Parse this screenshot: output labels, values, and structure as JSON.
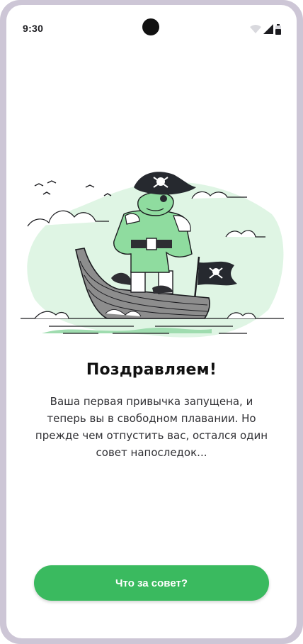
{
  "status_bar": {
    "time": "9:30",
    "icons": [
      "wifi-icon",
      "signal-icon",
      "battery-icon"
    ]
  },
  "illustration": {
    "subject": "pirate-frog-in-boat-illustration"
  },
  "content": {
    "title": "Поздравляем!",
    "body": "Ваша первая привычка запущена, и теперь вы в свободном плавании. Но прежде чем отпустить вас, остался один совет напоследок..."
  },
  "cta": {
    "label": "Что за совет?"
  },
  "colors": {
    "accent": "#3aba5f",
    "accent_light": "#dff5e4",
    "frame": "#cdc6d6",
    "ink": "#1b1b1f"
  }
}
